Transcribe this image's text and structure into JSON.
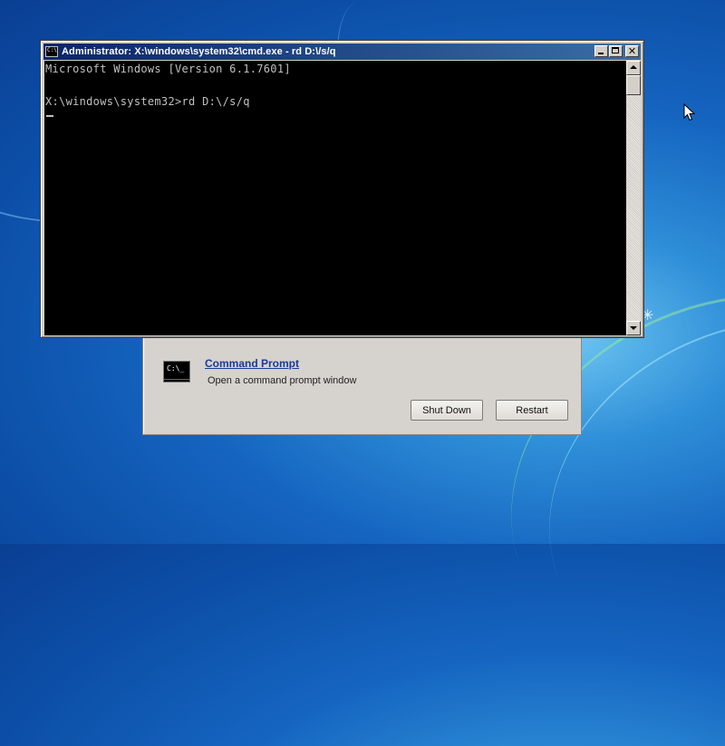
{
  "desktop": {
    "accent": "#1565c0"
  },
  "recovery": {
    "option_title": "Command Prompt",
    "option_description": "Open a command prompt window",
    "option_icon_text": "C:\\_",
    "shutdown_label": "Shut Down",
    "restart_label": "Restart"
  },
  "cmd": {
    "title": "Administrator: X:\\windows\\system32\\cmd.exe - rd  D:\\/s/q",
    "icon_text": "C:\\",
    "lines": [
      "Microsoft Windows [Version 6.1.7601]",
      "",
      "X:\\windows\\system32>rd D:\\/s/q"
    ],
    "titlebar_colors": [
      "#0a246a",
      "#3a6ea5"
    ],
    "text_color": "#c0c0c0",
    "background": "#000000"
  },
  "icons": {
    "minimize": "minimize-icon",
    "maximize": "maximize-icon",
    "close": "close-icon",
    "scroll_up": "arrow-up-icon",
    "scroll_down": "arrow-down-icon",
    "pointer": "mouse-pointer-icon",
    "command_prompt": "command-prompt-icon"
  }
}
